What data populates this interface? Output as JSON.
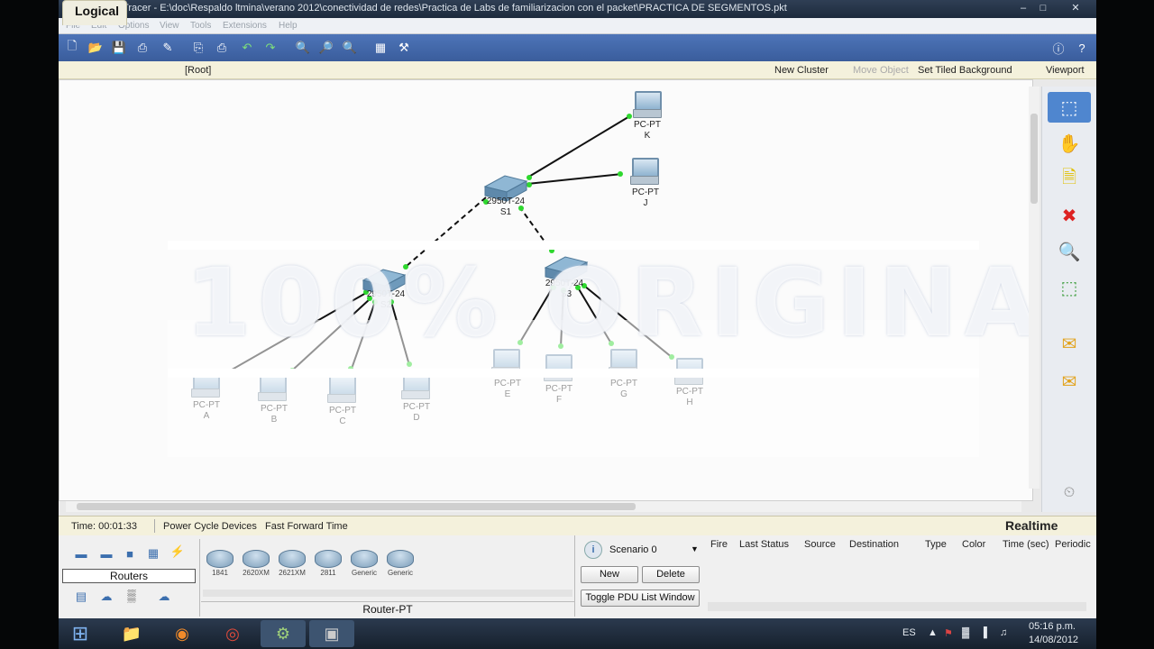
{
  "window": {
    "title": "Cisco Packet Tracer - E:\\doc\\Respaldo ltmina\\verano 2012\\conectividad de redes\\Practica de Labs de familiarizacion con el packet\\PRACTICA DE SEGMENTOS.pkt"
  },
  "menu": [
    "File",
    "Edit",
    "Options",
    "View",
    "Tools",
    "Extensions",
    "Help"
  ],
  "logical_bar": {
    "tab": "Logical",
    "root": "[Root]",
    "new_cluster": "New Cluster",
    "move_object": "Move Object",
    "set_background": "Set Tiled Background",
    "viewport": "Viewport"
  },
  "watermark": "100% ORIGINAL",
  "devices": {
    "s1": {
      "model": "2950T-24",
      "name": "S1"
    },
    "s2": {
      "model": "2950T-24",
      "name": "S2"
    },
    "s3": {
      "model": "2950T-24",
      "name": "S3"
    },
    "pcs": [
      {
        "type": "PC-PT",
        "name": "A"
      },
      {
        "type": "PC-PT",
        "name": "B"
      },
      {
        "type": "PC-PT",
        "name": "C"
      },
      {
        "type": "PC-PT",
        "name": "D"
      },
      {
        "type": "PC-PT",
        "name": "E"
      },
      {
        "type": "PC-PT",
        "name": "F"
      },
      {
        "type": "PC-PT",
        "name": "G"
      },
      {
        "type": "PC-PT",
        "name": "H"
      },
      {
        "type": "PC-PT",
        "name": "J"
      },
      {
        "type": "PC-PT",
        "name": "K"
      }
    ]
  },
  "status": {
    "time": "Time: 00:01:33",
    "power_cycle": "Power Cycle Devices",
    "fast_forward": "Fast Forward Time",
    "mode": "Realtime"
  },
  "device_panel": {
    "category": "Routers",
    "routers": [
      "1841",
      "2620XM",
      "2621XM",
      "2811",
      "Generic",
      "Generic"
    ],
    "selected_model": "Router-PT"
  },
  "scenario": {
    "select": "Scenario 0",
    "new": "New",
    "delete": "Delete",
    "toggle": "Toggle PDU List Window"
  },
  "pdu_columns": [
    "Fire",
    "Last Status",
    "Source",
    "Destination",
    "Type",
    "Color",
    "Time (sec)",
    "Periodic"
  ],
  "taskbar": {
    "lang": "ES",
    "time": "05:16 p.m.",
    "date": "14/08/2012"
  }
}
